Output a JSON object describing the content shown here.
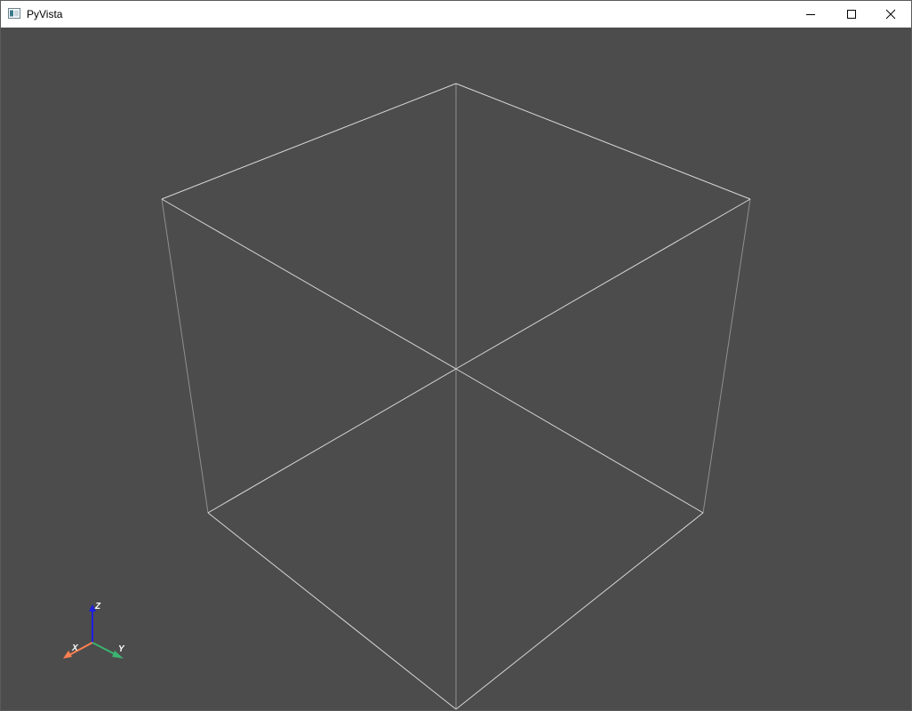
{
  "window": {
    "title": "PyVista",
    "app_icon": "pyvista-window-icon",
    "controls": {
      "minimize_icon": "minimize-icon",
      "maximize_icon": "maximize-icon",
      "close_icon": "close-icon"
    }
  },
  "viewport": {
    "background": "#4c4c4c",
    "edge_color": "#d9d9d9",
    "hidden_edge_color": "#9a9a9a"
  },
  "axes_widget": {
    "x_label": "X",
    "y_label": "Y",
    "z_label": "Z",
    "x_color": "#ff7f50",
    "y_color": "#3cb371",
    "z_color": "#1f1fe0"
  }
}
